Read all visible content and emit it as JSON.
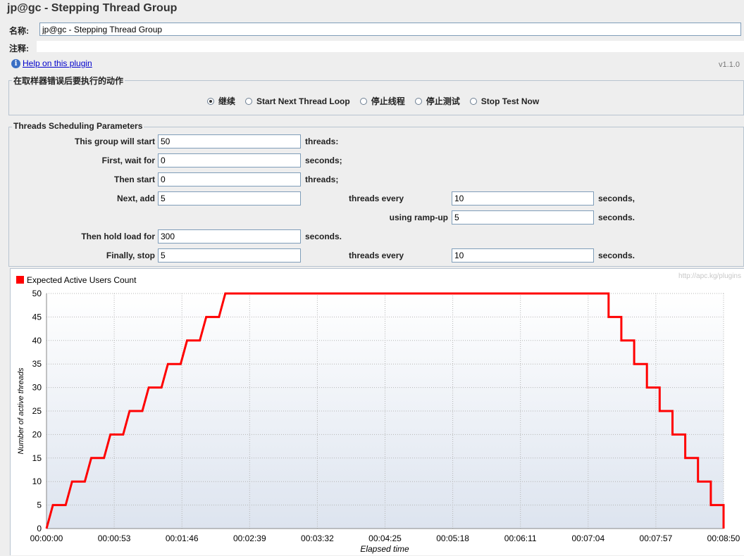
{
  "window": {
    "title": "jp@gc - Stepping Thread Group"
  },
  "form": {
    "name_label": "名称:",
    "name_value": "jp@gc - Stepping Thread Group",
    "comment_label": "注释:"
  },
  "help": {
    "link": "Help on this plugin",
    "icon": "info-icon",
    "version": "v1.1.0"
  },
  "sampler_error": {
    "title": "在取样器错误后要执行的动作",
    "options": [
      "继续",
      "Start Next Thread Loop",
      "停止线程",
      "停止测试",
      "Stop Test Now"
    ],
    "selected": "继续"
  },
  "scheduling": {
    "title": "Threads Scheduling Parameters",
    "start_threads_label": "This group will start",
    "start_threads_value": "50",
    "start_threads_unit": "threads:",
    "initial_delay_label": "First, wait for",
    "initial_delay_value": "0",
    "initial_delay_unit": "seconds;",
    "then_start_label": "Then start",
    "then_start_value": "0",
    "then_start_unit": "threads;",
    "next_add_label": "Next, add",
    "next_add_value": "5",
    "next_add_mid": "threads every",
    "next_add_period": "10",
    "next_add_unit": "seconds,",
    "rampup_label": "using ramp-up",
    "rampup_value": "5",
    "rampup_unit": "seconds.",
    "hold_label": "Then hold load for",
    "hold_value": "300",
    "hold_unit": "seconds.",
    "stop_label": "Finally, stop",
    "stop_value": "5",
    "stop_mid": "threads every",
    "stop_period": "10",
    "stop_unit": "seconds."
  },
  "chart_data": {
    "type": "line",
    "watermark": "http://apc.kg/plugins",
    "legend": "Expected Active Users Count",
    "legend_position": "top-left",
    "series_color": "#ff0000",
    "grid": true,
    "xlabel": "Elapsed time",
    "ylabel": "Number of active threads",
    "ylim": [
      0,
      50
    ],
    "y_ticks": [
      "0",
      "5",
      "10",
      "15",
      "20",
      "25",
      "30",
      "35",
      "40",
      "45",
      "50"
    ],
    "x_tick_labels": [
      "00:00:00",
      "00:00:53",
      "00:01:46",
      "00:02:39",
      "00:03:32",
      "00:04:25",
      "00:05:18",
      "00:06:11",
      "00:07:04",
      "00:07:57",
      "00:08:50"
    ],
    "x_range_seconds": [
      0,
      530
    ],
    "points_seconds": [
      [
        0,
        0
      ],
      [
        5,
        5
      ],
      [
        15,
        5
      ],
      [
        20,
        10
      ],
      [
        30,
        10
      ],
      [
        35,
        15
      ],
      [
        45,
        15
      ],
      [
        50,
        20
      ],
      [
        60,
        20
      ],
      [
        65,
        25
      ],
      [
        75,
        25
      ],
      [
        80,
        30
      ],
      [
        90,
        30
      ],
      [
        95,
        35
      ],
      [
        105,
        35
      ],
      [
        110,
        40
      ],
      [
        120,
        40
      ],
      [
        125,
        45
      ],
      [
        135,
        45
      ],
      [
        140,
        50
      ],
      [
        440,
        50
      ],
      [
        440,
        45
      ],
      [
        450,
        45
      ],
      [
        450,
        40
      ],
      [
        460,
        40
      ],
      [
        460,
        35
      ],
      [
        470,
        35
      ],
      [
        470,
        30
      ],
      [
        480,
        30
      ],
      [
        480,
        25
      ],
      [
        490,
        25
      ],
      [
        490,
        20
      ],
      [
        500,
        20
      ],
      [
        500,
        15
      ],
      [
        510,
        15
      ],
      [
        510,
        10
      ],
      [
        520,
        10
      ],
      [
        520,
        5
      ],
      [
        530,
        5
      ],
      [
        530,
        0
      ]
    ]
  }
}
